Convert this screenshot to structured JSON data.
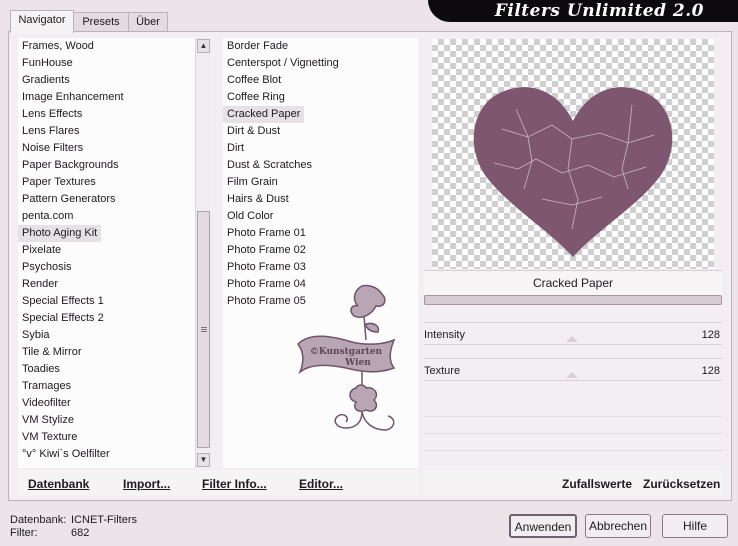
{
  "tabs": [
    {
      "label": "Navigator"
    },
    {
      "label": "Presets"
    },
    {
      "label": "Über"
    }
  ],
  "app_title": "Filters Unlimited 2.0",
  "categories": [
    "Frames, Wood",
    "FunHouse",
    "Gradients",
    "Image Enhancement",
    "Lens Effects",
    "Lens Flares",
    "Noise Filters",
    "Paper Backgrounds",
    "Paper Textures",
    "Pattern Generators",
    "penta.com",
    "Photo Aging Kit",
    "Pixelate",
    "Psychosis",
    "Render",
    "Special Effects 1",
    "Special Effects 2",
    "Sybia",
    "Tile & Mirror",
    "Toadies",
    "Tramages",
    "Videofilter",
    "VM Stylize",
    "VM Texture",
    "°v° Kiwi`s Oelfilter"
  ],
  "selected_category": "Photo Aging Kit",
  "filters": [
    "Border Fade",
    "Centerspot / Vignetting",
    "Coffee Blot",
    "Coffee Ring",
    "Cracked Paper",
    "Dirt & Dust",
    "Dirt",
    "Dust & Scratches",
    "Film Grain",
    "Hairs & Dust",
    "Old Color",
    "Photo Frame 01",
    "Photo Frame 02",
    "Photo Frame 03",
    "Photo Frame 04",
    "Photo Frame 05"
  ],
  "selected_filter": "Cracked Paper",
  "watermark": {
    "line1": "©Kunstgarten",
    "line2": "Wien"
  },
  "preview": {
    "filter_name": "Cracked Paper",
    "heart_color": "#7e5670",
    "checker_color": "#cfcfcf"
  },
  "params": [
    {
      "label": "Intensity",
      "value": "128"
    },
    {
      "label": "Texture",
      "value": "128"
    }
  ],
  "links": {
    "database": "Datenbank",
    "import": "Import...",
    "filter_info": "Filter Info...",
    "editor": "Editor...",
    "random": "Zufallswerte",
    "reset": "Zurücksetzen"
  },
  "status": {
    "database_label": "Datenbank:",
    "database_value": "ICNET-Filters",
    "filter_label": "Filter:",
    "filter_value": "682"
  },
  "buttons": {
    "apply": "Anwenden",
    "cancel": "Abbrechen",
    "help": "Hilfe"
  },
  "icons": {
    "scroll_up": "▲",
    "scroll_down": "▼"
  }
}
